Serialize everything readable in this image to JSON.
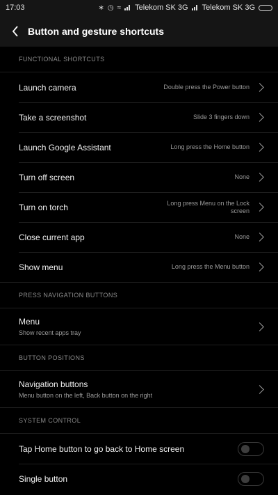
{
  "status_bar": {
    "time": "17:03",
    "carrier1": "Telekom SK 3G",
    "carrier2": "Telekom SK 3G"
  },
  "header": {
    "title": "Button and gesture shortcuts"
  },
  "sections": {
    "functional": {
      "title": "FUNCTIONAL SHORTCUTS",
      "items": [
        {
          "label": "Launch camera",
          "value": "Double press the Power button"
        },
        {
          "label": "Take a screenshot",
          "value": "Slide 3 fingers down"
        },
        {
          "label": "Launch Google Assistant",
          "value": "Long press the Home button"
        },
        {
          "label": "Turn off screen",
          "value": "None"
        },
        {
          "label": "Turn on torch",
          "value": "Long press Menu on the Lock screen"
        },
        {
          "label": "Close current app",
          "value": "None"
        },
        {
          "label": "Show menu",
          "value": "Long press the Menu button"
        }
      ]
    },
    "press_nav": {
      "title": "PRESS NAVIGATION BUTTONS",
      "items": [
        {
          "label": "Menu",
          "sublabel": "Show recent apps tray"
        }
      ]
    },
    "positions": {
      "title": "BUTTON POSITIONS",
      "items": [
        {
          "label": "Navigation buttons",
          "sublabel": "Menu button on the left, Back button on the right"
        }
      ]
    },
    "system": {
      "title": "SYSTEM CONTROL",
      "items": [
        {
          "label": "Tap Home button to go back to Home screen",
          "enabled": false
        },
        {
          "label": "Single button",
          "enabled": false
        }
      ]
    }
  }
}
